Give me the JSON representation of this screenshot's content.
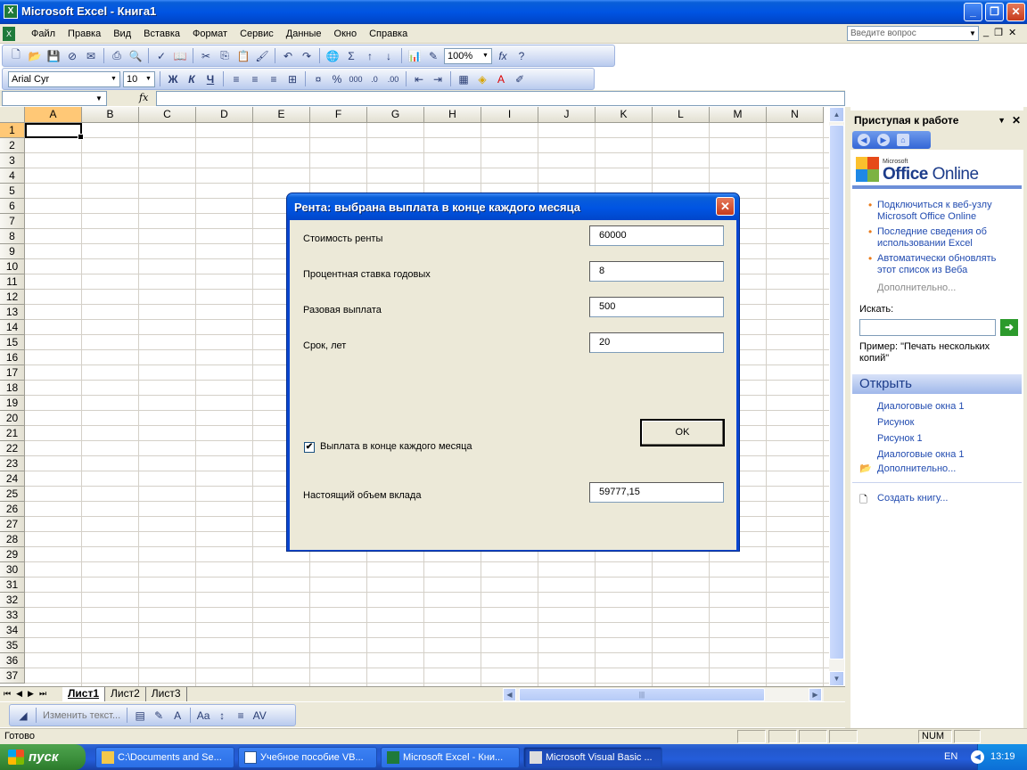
{
  "window": {
    "title": "Microsoft Excel - Книга1",
    "min": "_",
    "max": "❐",
    "close": "✕"
  },
  "menu": {
    "items": [
      "Файл",
      "Правка",
      "Вид",
      "Вставка",
      "Формат",
      "Сервис",
      "Данные",
      "Окно",
      "Справка"
    ],
    "ask_placeholder": "Введите вопрос"
  },
  "toolbar1": {
    "zoom": "100%"
  },
  "toolbar2": {
    "font": "Arial Cyr",
    "size": "10",
    "bold": "Ж",
    "italic": "К",
    "underline": "Ч",
    "percent": "%",
    "thousands": "000"
  },
  "formula": {
    "fx": "fx",
    "namebox": ""
  },
  "grid": {
    "columns": [
      "A",
      "B",
      "C",
      "D",
      "E",
      "F",
      "G",
      "H",
      "I",
      "J",
      "K",
      "L",
      "M",
      "N"
    ],
    "rows": [
      "1",
      "2",
      "3",
      "4",
      "5",
      "6",
      "7",
      "8",
      "9",
      "10",
      "11",
      "12",
      "13",
      "14",
      "15",
      "16",
      "17",
      "18",
      "19",
      "20",
      "21",
      "22",
      "23",
      "24",
      "25",
      "26",
      "27",
      "28",
      "29",
      "30",
      "31",
      "32",
      "33",
      "34",
      "35",
      "36",
      "37"
    ]
  },
  "sheets": {
    "tabs": [
      "Лист1",
      "Лист2",
      "Лист3"
    ]
  },
  "drawbar": {
    "edit_text": "Изменить текст..."
  },
  "status": {
    "ready": "Готово",
    "num": "NUM"
  },
  "taskpane": {
    "title": "Приступая к работе",
    "logo_small": "Microsoft",
    "logo_office": "Office",
    "logo_online": "Online",
    "links": [
      "Подключиться к веб-узлу Microsoft Office Online",
      "Последние сведения об использовании Excel",
      "Автоматически обновлять этот список из Веба"
    ],
    "more": "Дополнительно...",
    "search_label": "Искать:",
    "example": "Пример: \"Печать нескольких копий\"",
    "open_title": "Открыть",
    "open_items": [
      "Диалоговые окна 1",
      "Рисунок",
      "Рисунок 1",
      "Диалоговые окна 1"
    ],
    "open_more": "Дополнительно...",
    "create": "Создать книгу..."
  },
  "dialog": {
    "title": "Рента: выбрана выплата в конце каждого месяца",
    "fields": [
      {
        "label": "Стоимость ренты",
        "value": "60000"
      },
      {
        "label": "Процентная ставка годовых",
        "value": "8"
      },
      {
        "label": "Разовая выплата",
        "value": "500"
      },
      {
        "label": "Срок, лет",
        "value": "20"
      }
    ],
    "checkbox_label": "Выплата в конце каждого месяца",
    "checkbox_checked": true,
    "check_mark": "✔",
    "ok": "OK",
    "result_label": "Настоящий объем вклада",
    "result_value": "59777,15"
  },
  "taskbar": {
    "start": "пуск",
    "tasks": [
      "C:\\Documents and Se...",
      "Учебное пособие VB...",
      "Microsoft Excel - Кни...",
      "Microsoft Visual Basic ..."
    ],
    "lang": "EN",
    "time": "13:19"
  }
}
